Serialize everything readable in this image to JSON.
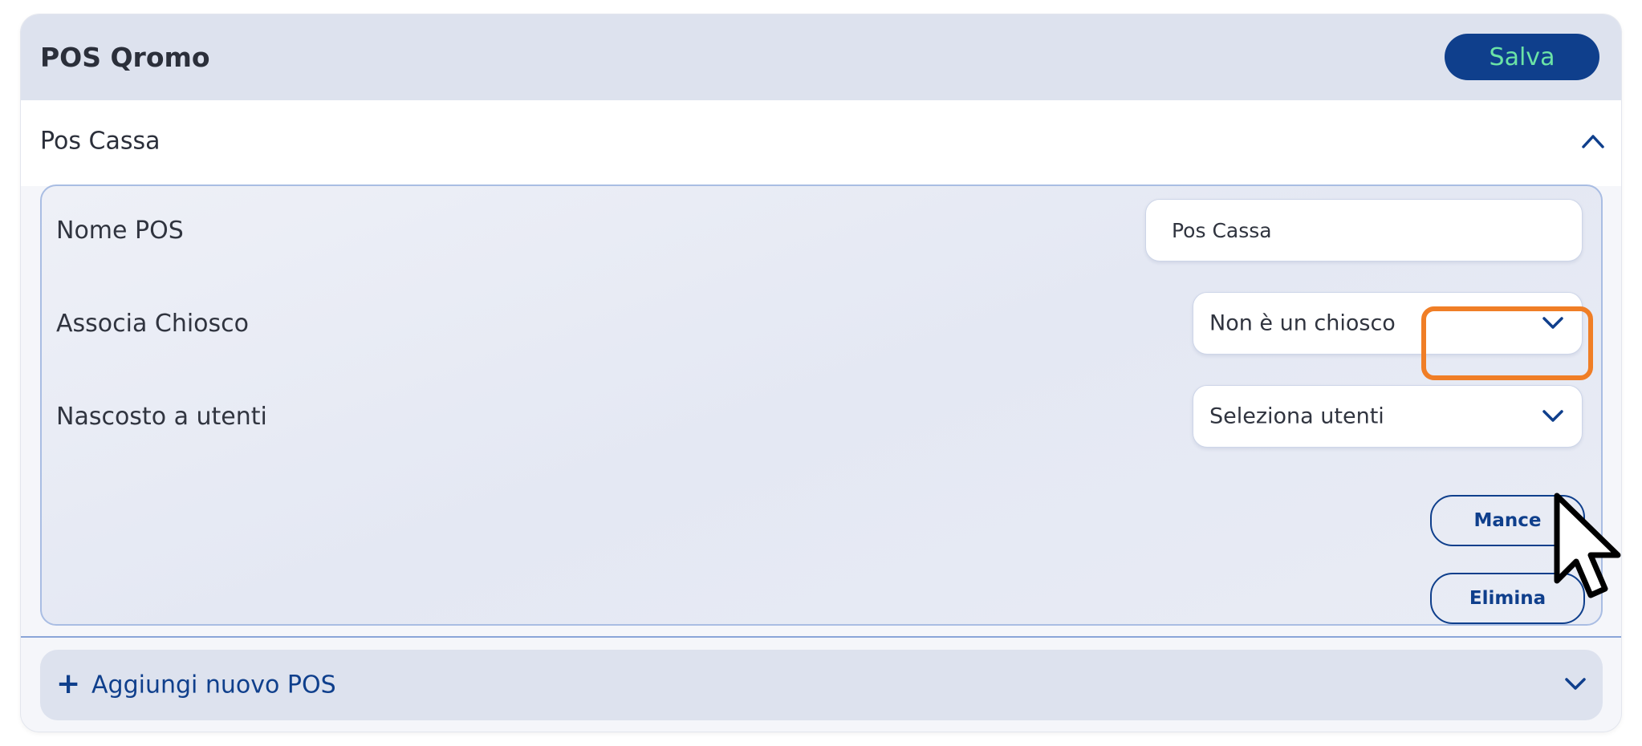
{
  "header": {
    "title": "POS Qromo",
    "save_label": "Salva"
  },
  "section": {
    "title": "Pos Cassa",
    "collapse_icon": "chevron-up-icon",
    "fields": {
      "name_label": "Nome POS",
      "name_value": "Pos Cassa",
      "kiosk_label": "Associa Chiosco",
      "kiosk_value": "Non è un chiosco",
      "hidden_label": "Nascosto a utenti",
      "hidden_value": "Seleziona utenti"
    },
    "buttons": {
      "tips_label": "Mance",
      "delete_label": "Elimina"
    }
  },
  "add_pos": {
    "label": "Aggiungi nuovo POS",
    "icon": "plus-icon",
    "expand_icon": "chevron-down-icon"
  },
  "colors": {
    "accent": "#0f3f8c",
    "save_text": "#6be3a6",
    "highlight": "#f07e26",
    "header_bg": "#dde2ee"
  }
}
